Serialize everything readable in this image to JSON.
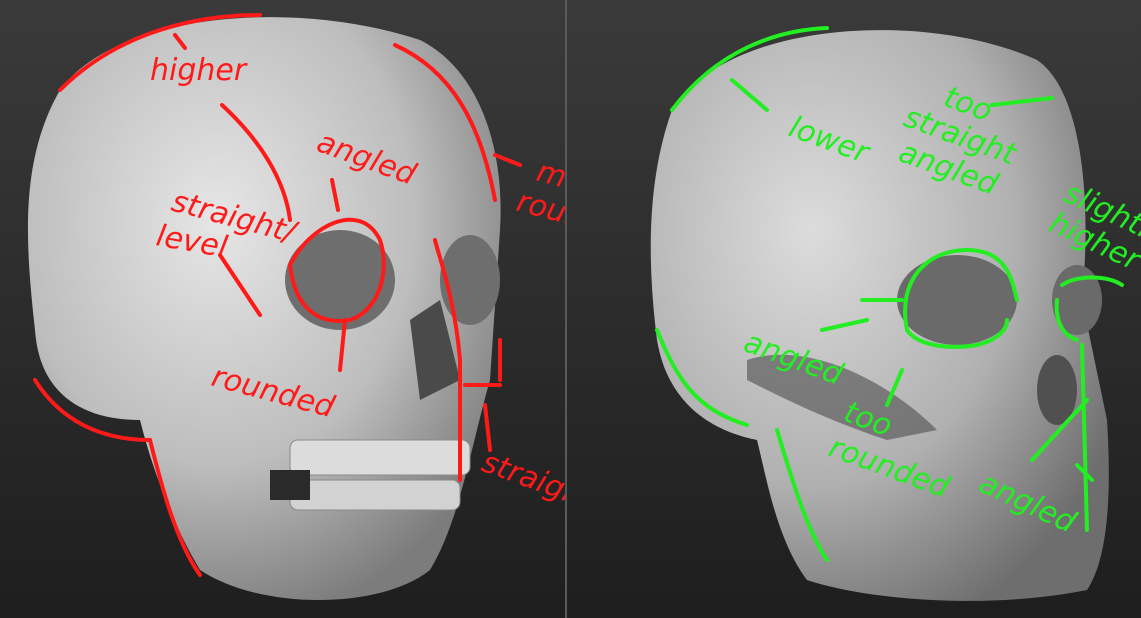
{
  "left_notes": {
    "higher": "higher",
    "angled": "angled",
    "straight": "straight/",
    "level": "level",
    "rounded": "rounded",
    "more": "more",
    "more_rounded": "rounded",
    "straight_right": "straight"
  },
  "right_notes": {
    "lower": "lower",
    "too1": "too",
    "straight_angled1": "straight",
    "straight_angled2": "angled",
    "slightly": "slightly",
    "higher": "higher",
    "angled1": "angled",
    "too2": "too",
    "too_rounded": "rounded",
    "angled2": "angled"
  },
  "colors": {
    "left_annotation": "#ff1a1a",
    "right_annotation": "#22ee22",
    "background": "#2a2a2a"
  }
}
